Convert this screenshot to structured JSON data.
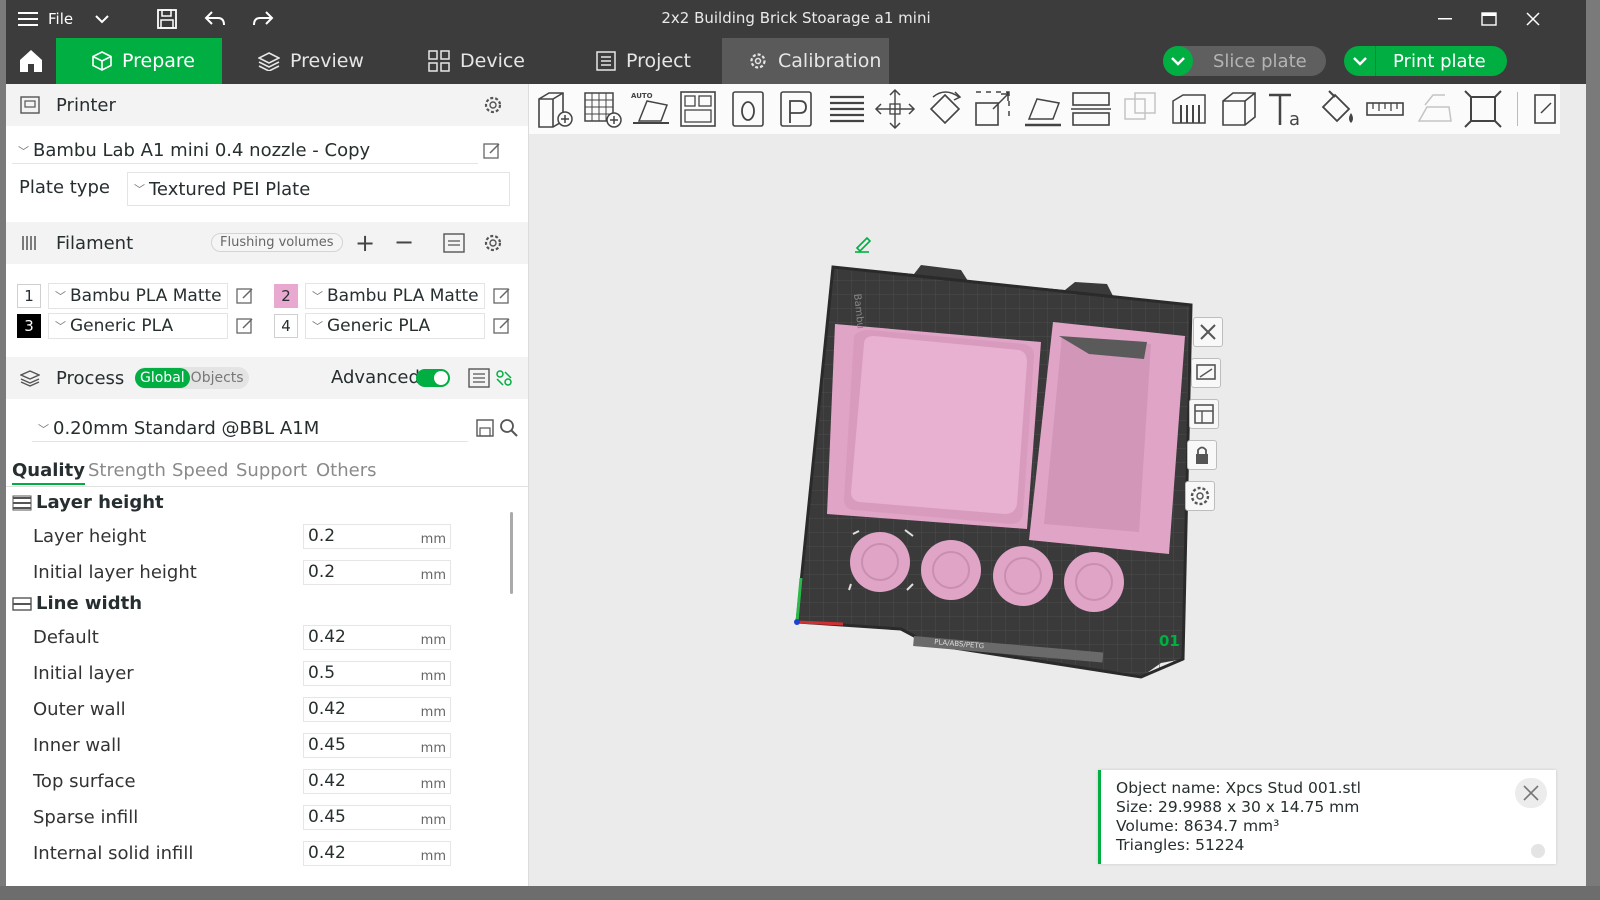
{
  "window": {
    "title": "2x2 Building Brick Stoarage a1 mini",
    "menu_label": "File"
  },
  "tabs": [
    {
      "label": "Prepare"
    },
    {
      "label": "Preview"
    },
    {
      "label": "Device"
    },
    {
      "label": "Project"
    },
    {
      "label": "Calibration"
    }
  ],
  "actions": {
    "slice_label": "Slice plate",
    "print_label": "Print plate"
  },
  "printer": {
    "section_title": "Printer",
    "preset": "Bambu Lab A1 mini 0.4 nozzle - Copy",
    "plate_type_label": "Plate type",
    "plate_type_value": "Textured PEI Plate"
  },
  "filament": {
    "section_title": "Filament",
    "flushing_label": "Flushing volumes",
    "slots": [
      {
        "num": "1",
        "name": "Bambu PLA Matte",
        "color": "#ffffff"
      },
      {
        "num": "2",
        "name": "Bambu PLA Matte",
        "color": "#e9a8cf"
      },
      {
        "num": "3",
        "name": "Generic PLA",
        "color": "#000000"
      },
      {
        "num": "4",
        "name": "Generic PLA",
        "color": "#ffffff"
      }
    ]
  },
  "process": {
    "section_title": "Process",
    "global_label": "Global",
    "objects_label": "Objects",
    "advanced_label": "Advanced",
    "preset": "0.20mm Standard @BBL A1M",
    "tabs": [
      "Quality",
      "Strength",
      "Speed",
      "Support",
      "Others"
    ],
    "groups": [
      {
        "title": "Layer height",
        "rows": [
          {
            "label": "Layer height",
            "value": "0.2",
            "unit": "mm"
          },
          {
            "label": "Initial layer height",
            "value": "0.2",
            "unit": "mm"
          }
        ]
      },
      {
        "title": "Line width",
        "rows": [
          {
            "label": "Default",
            "value": "0.42",
            "unit": "mm"
          },
          {
            "label": "Initial layer",
            "value": "0.5",
            "unit": "mm"
          },
          {
            "label": "Outer wall",
            "value": "0.42",
            "unit": "mm"
          },
          {
            "label": "Inner wall",
            "value": "0.45",
            "unit": "mm"
          },
          {
            "label": "Top surface",
            "value": "0.42",
            "unit": "mm"
          },
          {
            "label": "Sparse infill",
            "value": "0.45",
            "unit": "mm"
          },
          {
            "label": "Internal solid infill",
            "value": "0.42",
            "unit": "mm"
          }
        ]
      }
    ]
  },
  "viewport": {
    "plate_number": "01",
    "plate_brand": "Bambu",
    "plate_text": "PLA/ABS/PETG"
  },
  "object_info": {
    "name_line": "Object name: Xpcs Stud 001.stl",
    "size_line": "Size: 29.9988 x 30 x 14.75 mm",
    "volume_line": "Volume: 8634.7 mm³",
    "triangles_line": "Triangles: 51224"
  },
  "colors": {
    "accent": "#00ae42",
    "model": "#e9a8cf",
    "plate": "#3a3a3a"
  }
}
